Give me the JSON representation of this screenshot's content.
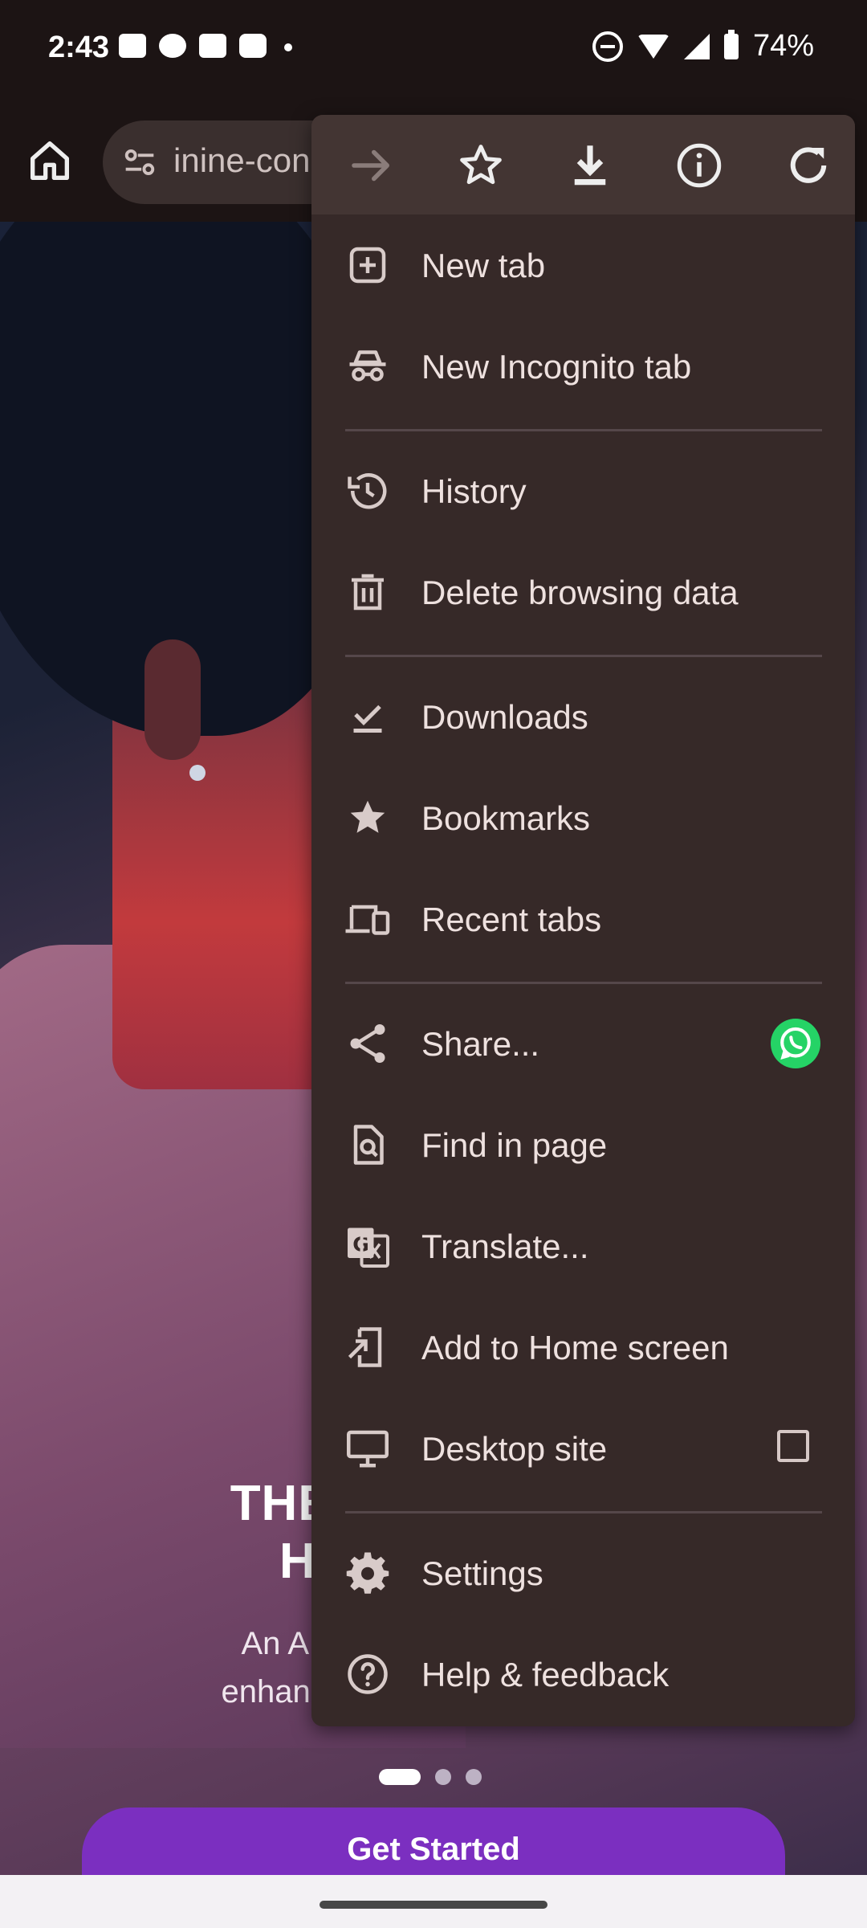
{
  "status_bar": {
    "time": "2:43",
    "battery": "74%",
    "notification_icons": [
      "message-icon",
      "chat-icon",
      "message-icon",
      "youtube-icon"
    ]
  },
  "toolbar": {
    "url_text": "inine-con"
  },
  "page": {
    "hero_title_line1": "THE WOM",
    "hero_title_line2": "HEA",
    "hero_sub_line1": "An AI-Powe",
    "hero_sub_line2": "enhanceme",
    "cta_label": "Get Started"
  },
  "menu": {
    "top_actions": [
      "forward-icon",
      "bookmark-star-icon",
      "download-icon",
      "info-icon",
      "refresh-icon"
    ],
    "items": [
      {
        "label": "New tab"
      },
      {
        "label": "New Incognito tab"
      },
      {
        "label": "History"
      },
      {
        "label": "Delete browsing data"
      },
      {
        "label": "Downloads"
      },
      {
        "label": "Bookmarks"
      },
      {
        "label": "Recent tabs"
      },
      {
        "label": "Share..."
      },
      {
        "label": "Find in page"
      },
      {
        "label": "Translate..."
      },
      {
        "label": "Add to Home screen"
      },
      {
        "label": "Desktop site"
      },
      {
        "label": "Settings"
      },
      {
        "label": "Help & feedback"
      }
    ],
    "desktop_site_checked": false
  },
  "colors": {
    "menu_bg": "#362928",
    "menu_top_bg": "#433533",
    "cta_bg": "#7b2fc0",
    "whatsapp": "#25d366"
  }
}
